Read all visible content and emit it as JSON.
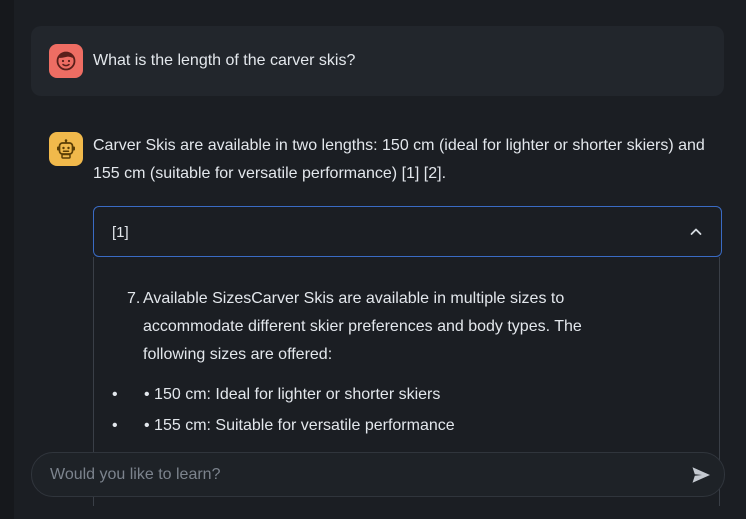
{
  "conversation": {
    "user_message": {
      "avatar_icon": "smiling-face-icon",
      "text": "What is the length of the carver skis?"
    },
    "bot_message": {
      "avatar_icon": "robot-icon",
      "text": "Carver Skis are available in two lengths: 150 cm (ideal for lighter or shorter skiers) and 155 cm (suitable for versatile performance) [1] [2]."
    },
    "citation": {
      "title": "[1]",
      "expanded": true,
      "toggle_icon": "chevron-up-icon",
      "item_number": "7.",
      "item_text": "Available SizesCarver Skis are available in multiple sizes to accommodate different skier preferences and body types. The following sizes are offered:",
      "bullets": [
        "• 150 cm: Ideal for lighter or shorter skiers",
        "• 155 cm: Suitable for versatile performance"
      ]
    }
  },
  "composer": {
    "placeholder": "Would you like to learn?",
    "value": "",
    "send_icon": "send-icon"
  },
  "colors": {
    "background": "#1b1e23",
    "user_avatar": "#ee6d63",
    "bot_avatar": "#f1b94b",
    "citation_border": "#3a6bc4"
  }
}
